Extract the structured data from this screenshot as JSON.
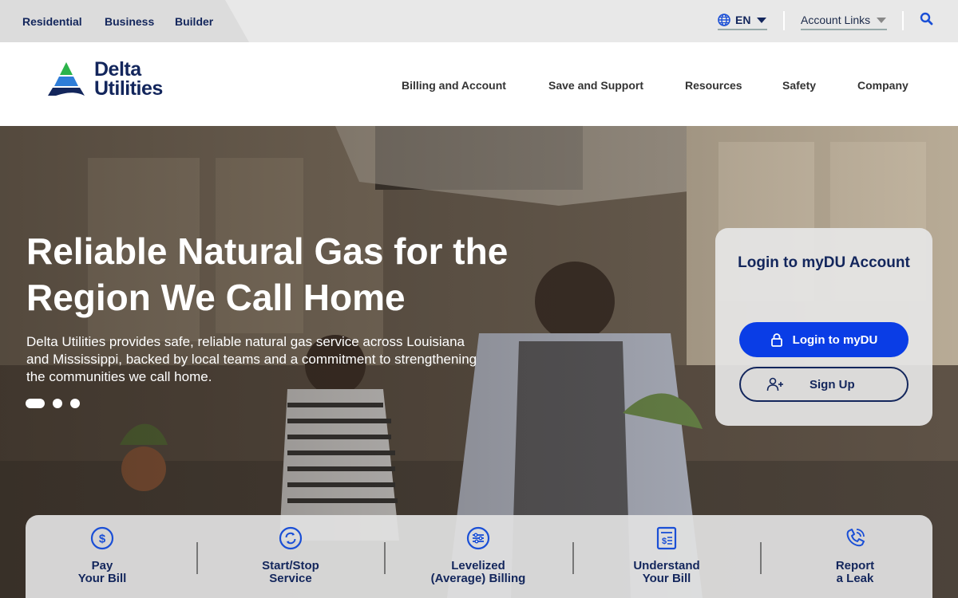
{
  "utility_bar": {
    "segments": [
      "Residential",
      "Business",
      "Builder"
    ],
    "language": "EN",
    "account_links": "Account Links"
  },
  "header": {
    "logo_line1": "Delta",
    "logo_line2": "Utilities",
    "nav": [
      "Billing and Account",
      "Save and Support",
      "Resources",
      "Safety",
      "Company"
    ]
  },
  "hero": {
    "title": "Reliable Natural Gas for the Region We Call Home",
    "description": "Delta Utilities provides safe, reliable natural gas service across Louisiana and Mississippi, backed by local teams and a commitment to strengthening the communities we call home.",
    "slides": 3,
    "active_slide": 1
  },
  "login_card": {
    "title": "Login to myDU Account",
    "login_button": "Login to myDU",
    "signup_button": "Sign Up"
  },
  "quick_links": [
    {
      "line1": "Pay",
      "line2": "Your Bill",
      "icon": "dollar-circle-icon"
    },
    {
      "line1": "Start/Stop",
      "line2": "Service",
      "icon": "cycle-circle-icon"
    },
    {
      "line1": "Levelized",
      "line2": "(Average) Billing",
      "icon": "sliders-circle-icon"
    },
    {
      "line1": "Understand",
      "line2": "Your Bill",
      "icon": "bill-document-icon"
    },
    {
      "line1": "Report",
      "line2": "a Leak",
      "icon": "phone-icon"
    }
  ],
  "colors": {
    "brand_navy": "#13265c",
    "brand_blue": "#0a3de6",
    "logo_green": "#2bb34a"
  }
}
